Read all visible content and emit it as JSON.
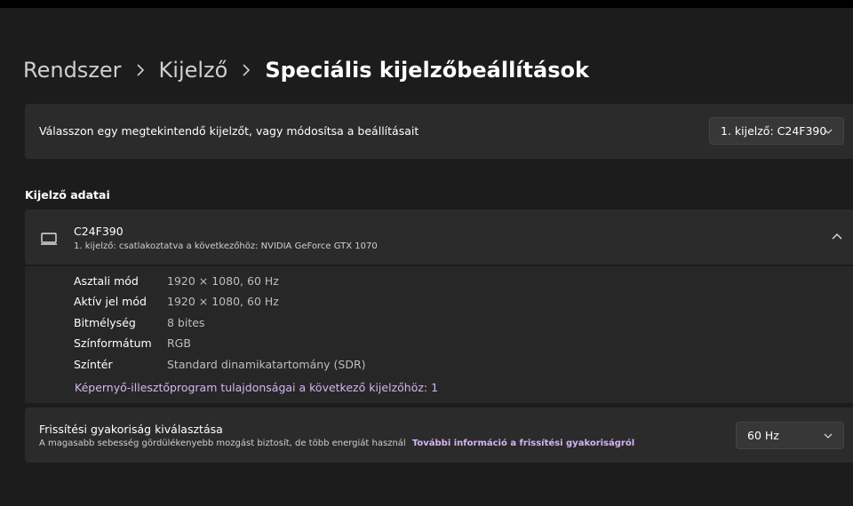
{
  "breadcrumb": {
    "items": [
      "Rendszer",
      "Kijelző"
    ],
    "current": "Speciális kijelzőbeállítások"
  },
  "display_select": {
    "label": "Válasszon egy megtekintendő kijelzőt, vagy módosítsa a beállításait",
    "value": "1. kijelző: C24F390"
  },
  "display_info": {
    "section_title": "Kijelző adatai",
    "monitor_name": "C24F390",
    "monitor_sub": "1. kijelző: csatlakoztatva a következőhöz: NVIDIA GeForce GTX 1070",
    "properties": [
      {
        "key": "Asztali mód",
        "value": "1920 × 1080, 60 Hz"
      },
      {
        "key": "Aktív jel mód",
        "value": "1920 × 1080, 60 Hz"
      },
      {
        "key": "Bitmélység",
        "value": "8 bites"
      },
      {
        "key": "Színformátum",
        "value": "RGB"
      },
      {
        "key": "Színtér",
        "value": "Standard dinamikatartomány (SDR)"
      }
    ],
    "adapter_link": "Képernyő-illesztőprogram tulajdonságai a következő kijelzőhöz: 1"
  },
  "refresh": {
    "title": "Frissítési gyakoriság kiválasztása",
    "description": "A magasabb sebesség gördülékenyebb mozgást biztosít, de több energiát használ",
    "link": "További információ a frissítési gyakoriságról",
    "value": "60 Hz"
  },
  "colors": {
    "accent_link": "#d6b4f3",
    "card_bg": "#2b2b2b",
    "page_bg": "#1c1c1c"
  }
}
